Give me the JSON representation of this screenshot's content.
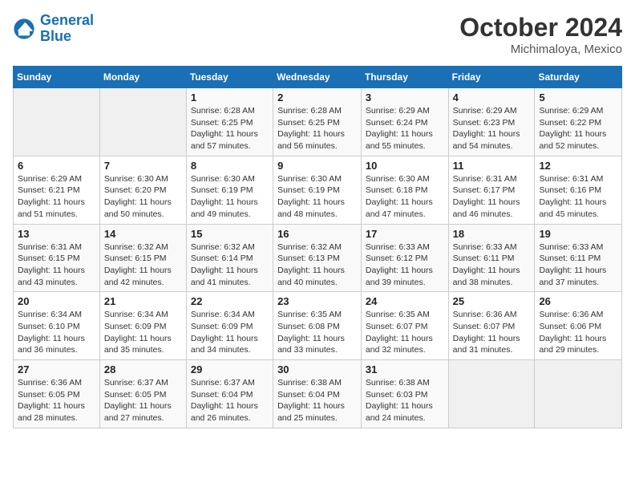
{
  "header": {
    "logo_line1": "General",
    "logo_line2": "Blue",
    "month": "October 2024",
    "location": "Michimaloya, Mexico"
  },
  "weekdays": [
    "Sunday",
    "Monday",
    "Tuesday",
    "Wednesday",
    "Thursday",
    "Friday",
    "Saturday"
  ],
  "weeks": [
    [
      {
        "day": "",
        "sunrise": "",
        "sunset": "",
        "daylight": "",
        "empty": true
      },
      {
        "day": "",
        "sunrise": "",
        "sunset": "",
        "daylight": "",
        "empty": true
      },
      {
        "day": "1",
        "sunrise": "Sunrise: 6:28 AM",
        "sunset": "Sunset: 6:25 PM",
        "daylight": "Daylight: 11 hours and 57 minutes."
      },
      {
        "day": "2",
        "sunrise": "Sunrise: 6:28 AM",
        "sunset": "Sunset: 6:25 PM",
        "daylight": "Daylight: 11 hours and 56 minutes."
      },
      {
        "day": "3",
        "sunrise": "Sunrise: 6:29 AM",
        "sunset": "Sunset: 6:24 PM",
        "daylight": "Daylight: 11 hours and 55 minutes."
      },
      {
        "day": "4",
        "sunrise": "Sunrise: 6:29 AM",
        "sunset": "Sunset: 6:23 PM",
        "daylight": "Daylight: 11 hours and 54 minutes."
      },
      {
        "day": "5",
        "sunrise": "Sunrise: 6:29 AM",
        "sunset": "Sunset: 6:22 PM",
        "daylight": "Daylight: 11 hours and 52 minutes."
      }
    ],
    [
      {
        "day": "6",
        "sunrise": "Sunrise: 6:29 AM",
        "sunset": "Sunset: 6:21 PM",
        "daylight": "Daylight: 11 hours and 51 minutes."
      },
      {
        "day": "7",
        "sunrise": "Sunrise: 6:30 AM",
        "sunset": "Sunset: 6:20 PM",
        "daylight": "Daylight: 11 hours and 50 minutes."
      },
      {
        "day": "8",
        "sunrise": "Sunrise: 6:30 AM",
        "sunset": "Sunset: 6:19 PM",
        "daylight": "Daylight: 11 hours and 49 minutes."
      },
      {
        "day": "9",
        "sunrise": "Sunrise: 6:30 AM",
        "sunset": "Sunset: 6:19 PM",
        "daylight": "Daylight: 11 hours and 48 minutes."
      },
      {
        "day": "10",
        "sunrise": "Sunrise: 6:30 AM",
        "sunset": "Sunset: 6:18 PM",
        "daylight": "Daylight: 11 hours and 47 minutes."
      },
      {
        "day": "11",
        "sunrise": "Sunrise: 6:31 AM",
        "sunset": "Sunset: 6:17 PM",
        "daylight": "Daylight: 11 hours and 46 minutes."
      },
      {
        "day": "12",
        "sunrise": "Sunrise: 6:31 AM",
        "sunset": "Sunset: 6:16 PM",
        "daylight": "Daylight: 11 hours and 45 minutes."
      }
    ],
    [
      {
        "day": "13",
        "sunrise": "Sunrise: 6:31 AM",
        "sunset": "Sunset: 6:15 PM",
        "daylight": "Daylight: 11 hours and 43 minutes."
      },
      {
        "day": "14",
        "sunrise": "Sunrise: 6:32 AM",
        "sunset": "Sunset: 6:15 PM",
        "daylight": "Daylight: 11 hours and 42 minutes."
      },
      {
        "day": "15",
        "sunrise": "Sunrise: 6:32 AM",
        "sunset": "Sunset: 6:14 PM",
        "daylight": "Daylight: 11 hours and 41 minutes."
      },
      {
        "day": "16",
        "sunrise": "Sunrise: 6:32 AM",
        "sunset": "Sunset: 6:13 PM",
        "daylight": "Daylight: 11 hours and 40 minutes."
      },
      {
        "day": "17",
        "sunrise": "Sunrise: 6:33 AM",
        "sunset": "Sunset: 6:12 PM",
        "daylight": "Daylight: 11 hours and 39 minutes."
      },
      {
        "day": "18",
        "sunrise": "Sunrise: 6:33 AM",
        "sunset": "Sunset: 6:11 PM",
        "daylight": "Daylight: 11 hours and 38 minutes."
      },
      {
        "day": "19",
        "sunrise": "Sunrise: 6:33 AM",
        "sunset": "Sunset: 6:11 PM",
        "daylight": "Daylight: 11 hours and 37 minutes."
      }
    ],
    [
      {
        "day": "20",
        "sunrise": "Sunrise: 6:34 AM",
        "sunset": "Sunset: 6:10 PM",
        "daylight": "Daylight: 11 hours and 36 minutes."
      },
      {
        "day": "21",
        "sunrise": "Sunrise: 6:34 AM",
        "sunset": "Sunset: 6:09 PM",
        "daylight": "Daylight: 11 hours and 35 minutes."
      },
      {
        "day": "22",
        "sunrise": "Sunrise: 6:34 AM",
        "sunset": "Sunset: 6:09 PM",
        "daylight": "Daylight: 11 hours and 34 minutes."
      },
      {
        "day": "23",
        "sunrise": "Sunrise: 6:35 AM",
        "sunset": "Sunset: 6:08 PM",
        "daylight": "Daylight: 11 hours and 33 minutes."
      },
      {
        "day": "24",
        "sunrise": "Sunrise: 6:35 AM",
        "sunset": "Sunset: 6:07 PM",
        "daylight": "Daylight: 11 hours and 32 minutes."
      },
      {
        "day": "25",
        "sunrise": "Sunrise: 6:36 AM",
        "sunset": "Sunset: 6:07 PM",
        "daylight": "Daylight: 11 hours and 31 minutes."
      },
      {
        "day": "26",
        "sunrise": "Sunrise: 6:36 AM",
        "sunset": "Sunset: 6:06 PM",
        "daylight": "Daylight: 11 hours and 29 minutes."
      }
    ],
    [
      {
        "day": "27",
        "sunrise": "Sunrise: 6:36 AM",
        "sunset": "Sunset: 6:05 PM",
        "daylight": "Daylight: 11 hours and 28 minutes."
      },
      {
        "day": "28",
        "sunrise": "Sunrise: 6:37 AM",
        "sunset": "Sunset: 6:05 PM",
        "daylight": "Daylight: 11 hours and 27 minutes."
      },
      {
        "day": "29",
        "sunrise": "Sunrise: 6:37 AM",
        "sunset": "Sunset: 6:04 PM",
        "daylight": "Daylight: 11 hours and 26 minutes."
      },
      {
        "day": "30",
        "sunrise": "Sunrise: 6:38 AM",
        "sunset": "Sunset: 6:04 PM",
        "daylight": "Daylight: 11 hours and 25 minutes."
      },
      {
        "day": "31",
        "sunrise": "Sunrise: 6:38 AM",
        "sunset": "Sunset: 6:03 PM",
        "daylight": "Daylight: 11 hours and 24 minutes."
      },
      {
        "day": "",
        "sunrise": "",
        "sunset": "",
        "daylight": "",
        "empty": true
      },
      {
        "day": "",
        "sunrise": "",
        "sunset": "",
        "daylight": "",
        "empty": true
      }
    ]
  ]
}
